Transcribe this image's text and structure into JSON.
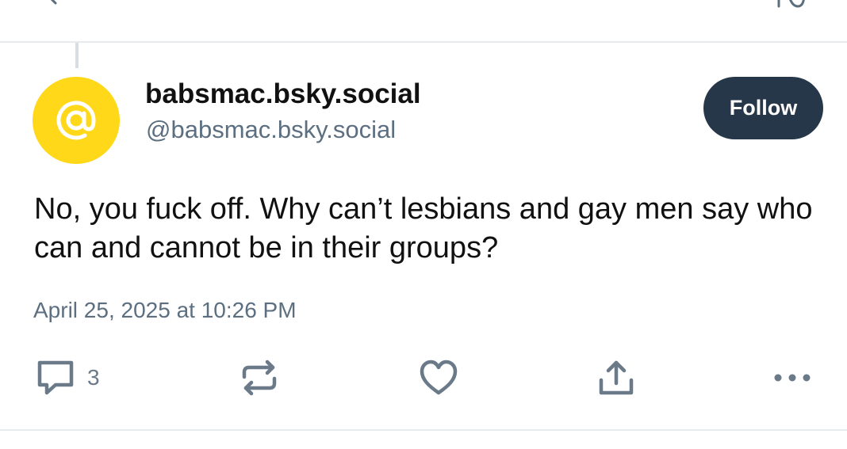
{
  "post": {
    "display_name": "babsmac.bsky.social",
    "handle": "@babsmac.bsky.social",
    "avatar_icon": "at-sign-icon",
    "avatar_color": "#ffd81a",
    "follow_label": "Follow",
    "text": "No, you fuck off. Why can’t lesbians and gay men say who can and cannot be in their groups?",
    "timestamp": "April 25, 2025 at 10:26 PM"
  },
  "actions": {
    "reply_count": "3",
    "reply_icon": "speech-bubble-icon",
    "repost_icon": "repost-icon",
    "like_icon": "heart-icon",
    "share_icon": "share-icon",
    "more_icon": "more-dots-icon"
  },
  "colors": {
    "accent_dark": "#27374a",
    "muted_text": "#5c6f80",
    "divider": "#e8ebee"
  }
}
